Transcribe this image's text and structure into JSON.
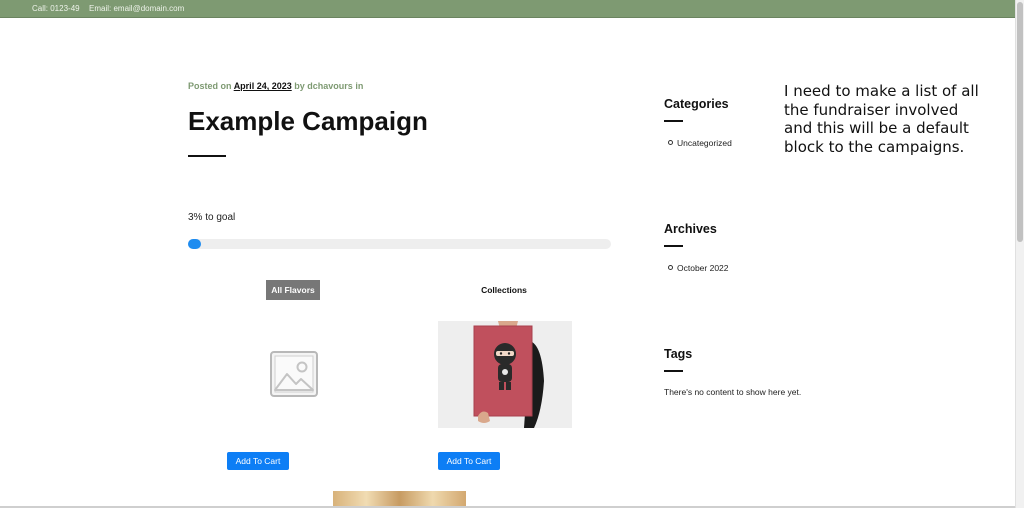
{
  "topbar": {
    "call": "Call: 0123-49",
    "email": "Email: email@domain.com"
  },
  "post": {
    "posted_on": "Posted on",
    "date": "April 24, 2023",
    "by": "by",
    "author": "dchavours",
    "in": "in",
    "title": "Example Campaign"
  },
  "campaign": {
    "goal_text": "3% to goal",
    "progress_fraction": 0.03
  },
  "tabs": {
    "active": "All Flavors",
    "other": "Collections"
  },
  "products": [
    {
      "image": "placeholder-image-icon",
      "button": "Add To Cart"
    },
    {
      "image": "ninja-poster-image",
      "button": "Add To Cart"
    }
  ],
  "sidebar": {
    "categories": {
      "heading": "Categories",
      "items": [
        "Uncategorized"
      ]
    },
    "archives": {
      "heading": "Archives",
      "items": [
        "October 2022"
      ]
    },
    "tags": {
      "heading": "Tags",
      "empty_text": "There's no content to show here yet."
    }
  },
  "note": "I need to make a list of all the fundraiser involved and this will be a default block to the campaigns.",
  "colors": {
    "topbar": "#7e9a72",
    "meta_accent": "#7e9a72",
    "progress": "#1e8cf0",
    "button": "#0d7ef5",
    "active_tab": "#777777"
  }
}
